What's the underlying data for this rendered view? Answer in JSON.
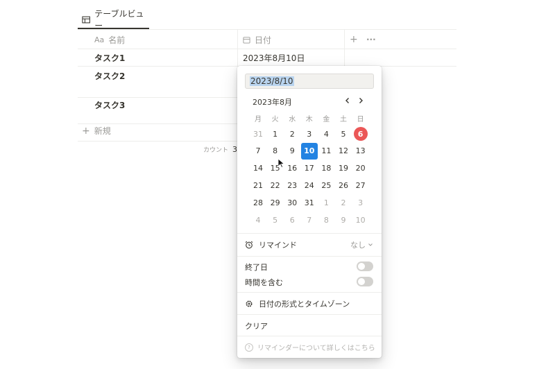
{
  "view": {
    "tab_label": "テーブルビュー"
  },
  "table": {
    "columns": [
      {
        "prefix": "Aa",
        "label": "名前"
      },
      {
        "label": "日付"
      }
    ],
    "add_column": "+",
    "more": "···",
    "rows": [
      {
        "name": "タスク1",
        "date": "2023年8月10日"
      },
      {
        "name": "タスク2",
        "date": ""
      },
      {
        "name": "タスク3",
        "date": ""
      }
    ],
    "new_label": "新規",
    "count_label": "カウント",
    "count_value": "3"
  },
  "picker": {
    "input_value": "2023/8/10",
    "month_label": "2023年8月",
    "weekdays": [
      "月",
      "火",
      "水",
      "木",
      "金",
      "土",
      "日"
    ],
    "weeks": [
      [
        "31",
        "1",
        "2",
        "3",
        "4",
        "5",
        "6"
      ],
      [
        "7",
        "8",
        "9",
        "10",
        "11",
        "12",
        "13"
      ],
      [
        "14",
        "15",
        "16",
        "17",
        "18",
        "19",
        "20"
      ],
      [
        "21",
        "22",
        "23",
        "24",
        "25",
        "26",
        "27"
      ],
      [
        "28",
        "29",
        "30",
        "31",
        "1",
        "2",
        "3"
      ],
      [
        "4",
        "5",
        "6",
        "7",
        "8",
        "9",
        "10"
      ]
    ],
    "selected_day": "10",
    "today_day": "6",
    "remind_label": "リマインド",
    "remind_value": "なし",
    "end_date_label": "終了日",
    "include_time_label": "時間を含む",
    "format_label": "日付の形式とタイムゾーン",
    "clear_label": "クリア",
    "help_label": "リマインダーについて詳しくはこちら",
    "colors": {
      "accent": "#2383e2",
      "today": "#eb5757"
    }
  }
}
